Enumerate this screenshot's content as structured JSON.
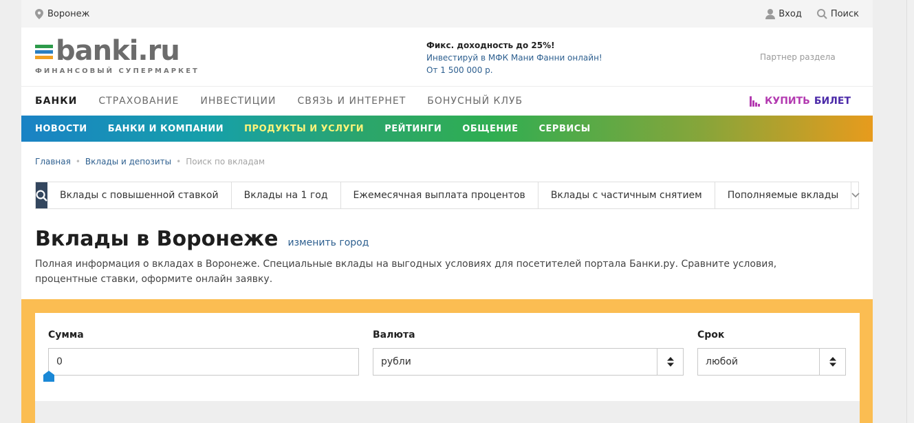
{
  "topbar": {
    "city": "Воронеж",
    "login": "Вход",
    "search": "Поиск"
  },
  "header": {
    "logo_word_a": "banki",
    "logo_word_b": ".ru",
    "logo_tagline": "ФИНАНСОВЫЙ СУПЕРМАРКЕТ",
    "promo_title": "Фикс. доходность до 25%!",
    "promo_line1": "Инвестируй в МФК Мани Фанни онлайн!",
    "promo_line2": "От 1 500 000 р.",
    "partner": "Партнер раздела"
  },
  "mainnav": {
    "items": [
      "БАНКИ",
      "СТРАХОВАНИЕ",
      "ИНВЕСТИЦИИ",
      "СВЯЗЬ И ИНТЕРНЕТ",
      "БОНУСНЫЙ КЛУБ"
    ],
    "ticket_a": "КУПИТЬ",
    "ticket_b": "БИЛЕТ"
  },
  "subnav": {
    "items": [
      "НОВОСТИ",
      "БАНКИ И КОМПАНИИ",
      "ПРОДУКТЫ И УСЛУГИ",
      "РЕЙТИНГИ",
      "ОБЩЕНИЕ",
      "СЕРВИСЫ"
    ]
  },
  "breadcrumbs": {
    "items": [
      "Главная",
      "Вклады и депозиты"
    ],
    "current": "Поиск по вкладам"
  },
  "filters": {
    "items": [
      "Вклады с повышенной ставкой",
      "Вклады на 1 год",
      "Ежемесячная выплата процентов",
      "Вклады с частичным снятием",
      "Пополняемые вклады"
    ]
  },
  "title": {
    "heading": "Вклады в Воронеже",
    "change_city": "изменить город"
  },
  "description": "Полная информация о вкладах в Воронеже. Специальные вклады на выгодных условиях для посетителей портала Банки.ру. Сравните условия, процентные ставки, оформите онлайн заявку.",
  "calc": {
    "amount_label": "Сумма",
    "amount_value": "0",
    "currency_label": "Валюта",
    "currency_value": "рубли",
    "term_label": "Срок",
    "term_value": "любой"
  },
  "colors": {
    "accent_blue": "#2d5f8f",
    "calc_bg": "#fbbd52",
    "search_bg": "#33465e",
    "ticket": "#b33ab0"
  }
}
